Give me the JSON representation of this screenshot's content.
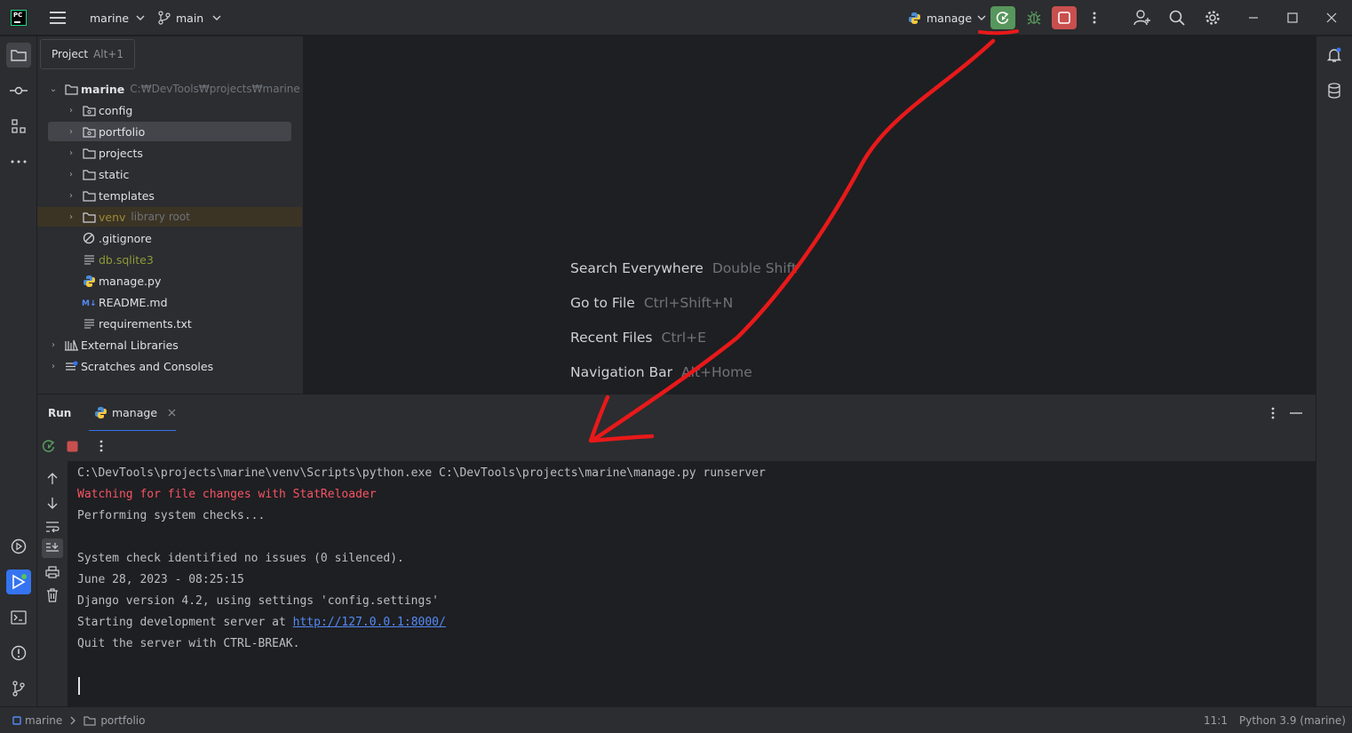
{
  "titlebar": {
    "project_name": "marine",
    "branch": "main",
    "run_config": "manage"
  },
  "project_panel": {
    "tab_label": "Project",
    "tab_shortcut": "Alt+1",
    "root": {
      "name": "marine",
      "path": "C:₩DevTools₩projects₩marine"
    },
    "items": [
      {
        "name": "config",
        "type": "folder-package"
      },
      {
        "name": "portfolio",
        "type": "folder-package"
      },
      {
        "name": "projects",
        "type": "folder"
      },
      {
        "name": "static",
        "type": "folder"
      },
      {
        "name": "templates",
        "type": "folder"
      },
      {
        "name": "venv",
        "type": "folder",
        "note": "library root"
      },
      {
        "name": ".gitignore",
        "type": "ignore-file"
      },
      {
        "name": "db.sqlite3",
        "type": "text-file"
      },
      {
        "name": "manage.py",
        "type": "python-file"
      },
      {
        "name": "README.md",
        "type": "markdown-file"
      },
      {
        "name": "requirements.txt",
        "type": "text-file"
      }
    ],
    "external_libraries": "External Libraries",
    "scratches": "Scratches and Consoles"
  },
  "editor_hints": [
    {
      "label": "Search Everywhere",
      "shortcut": "Double Shift"
    },
    {
      "label": "Go to File",
      "shortcut": "Ctrl+Shift+N"
    },
    {
      "label": "Recent Files",
      "shortcut": "Ctrl+E"
    },
    {
      "label": "Navigation Bar",
      "shortcut": "Alt+Home"
    }
  ],
  "run_panel": {
    "title": "Run",
    "tab_label": "manage"
  },
  "console": {
    "lines": [
      "C:\\DevTools\\projects\\marine\\venv\\Scripts\\python.exe C:\\DevTools\\projects\\marine\\manage.py runserver",
      "Watching for file changes with StatReloader",
      "Performing system checks...",
      "",
      "System check identified no issues (0 silenced).",
      "June 28, 2023 - 08:25:15",
      "Django version 4.2, using settings 'config.settings'",
      "Starting development server at ",
      "Quit the server with CTRL-BREAK."
    ],
    "server_url": "http://127.0.0.1:8000/"
  },
  "statusbar": {
    "breadcrumb_project": "marine",
    "breadcrumb_folder": "portfolio",
    "cursor_position": "11:1",
    "interpreter": "Python 3.9 (marine)"
  },
  "colors": {
    "accent": "#3574f0",
    "run_green": "#57965c",
    "stop_red": "#c94f4f",
    "console_red": "#f75464",
    "link_blue": "#548af7",
    "annotation_red": "#e8191a"
  }
}
